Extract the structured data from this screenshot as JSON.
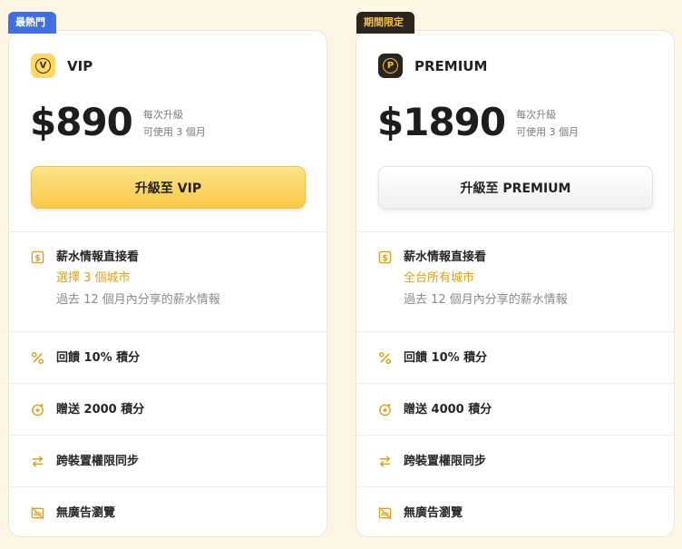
{
  "plans": [
    {
      "badge": "最熱門",
      "name": "VIP",
      "icon": "vip-coin-icon",
      "icon_letter": "V",
      "price": "$890",
      "price_note_1": "每次升級",
      "price_note_2": "可使用 3 個月",
      "cta_label": "升級至 VIP",
      "features": [
        {
          "icon": "dollar-icon",
          "title": "薪水情報直接看",
          "sub_accent": "選擇 3 個城市",
          "sub": "過去 12 個月內分享的薪水情報"
        },
        {
          "icon": "percent-icon",
          "title": "回饋 10% 積分"
        },
        {
          "icon": "gift-points-icon",
          "title": "贈送 2000 積分"
        },
        {
          "icon": "sync-arrows-icon",
          "title": "跨裝置權限同步"
        },
        {
          "icon": "no-ads-icon",
          "title": "無廣告瀏覽"
        }
      ]
    },
    {
      "badge": "期間限定",
      "name": "PREMIUM",
      "icon": "premium-coin-icon",
      "icon_letter": "P",
      "price": "$1890",
      "price_note_1": "每次升級",
      "price_note_2": "可使用 3 個月",
      "cta_label": "升級至 PREMIUM",
      "features": [
        {
          "icon": "dollar-icon",
          "title": "薪水情報直接看",
          "sub_accent": "全台所有城市",
          "sub": "過去 12 個月內分享的薪水情報"
        },
        {
          "icon": "percent-icon",
          "title": "回饋 10% 積分"
        },
        {
          "icon": "gift-points-icon",
          "title": "贈送 4000 積分"
        },
        {
          "icon": "sync-arrows-icon",
          "title": "跨裝置權限同步"
        },
        {
          "icon": "no-ads-icon",
          "title": "無廣告瀏覽"
        }
      ]
    }
  ],
  "colors": {
    "accent": "#d9a21a",
    "vip_badge": "#3f6fe0",
    "premium_badge": "#2b2520",
    "background": "#fdf6e4"
  }
}
